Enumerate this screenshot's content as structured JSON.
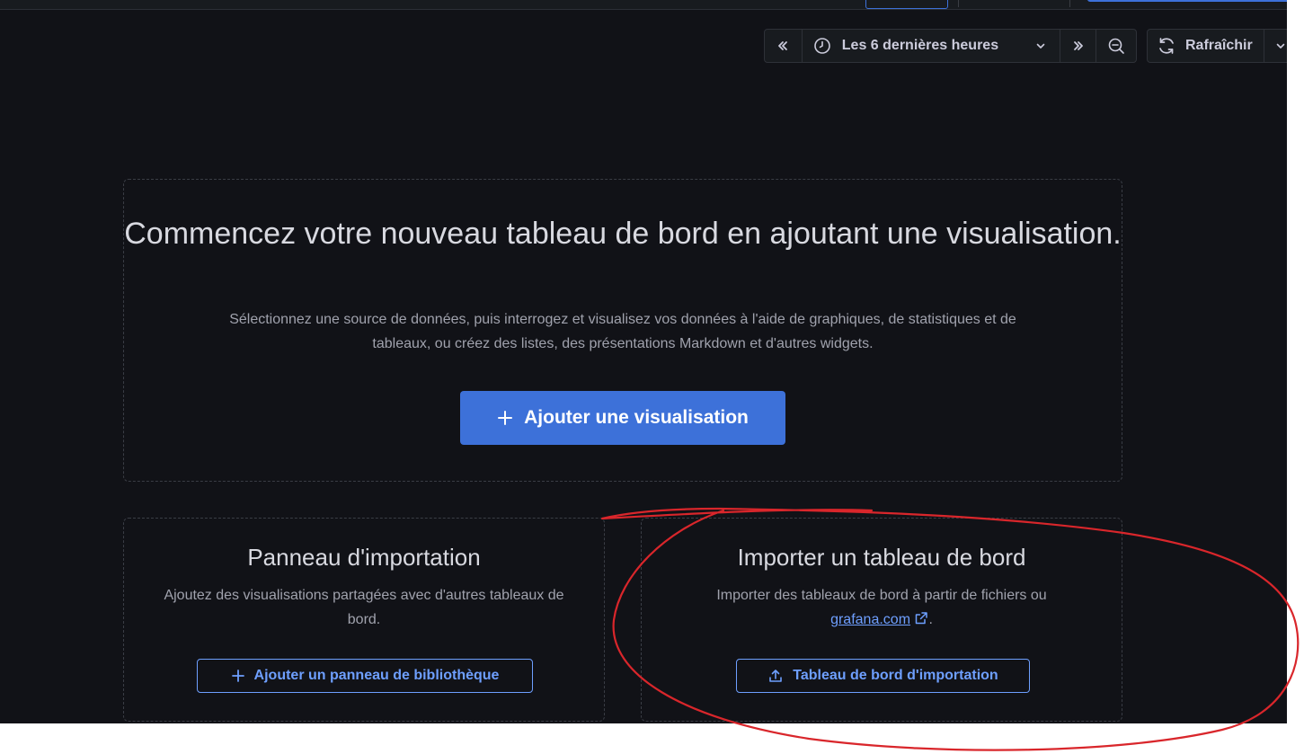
{
  "toolbar": {
    "time_range": "Les 6 dernières heures",
    "refresh": "Rafraîchir"
  },
  "hero": {
    "title": "Commencez votre nouveau tableau de bord en ajoutant une visualisation.",
    "description": "Sélectionnez une source de données, puis interrogez et visualisez vos données à l'aide de graphiques, de statistiques et de tableaux, ou créez des listes, des présentations Markdown et d'autres widgets.",
    "add_visualization": "Ajouter une visualisation"
  },
  "import_panel": {
    "title": "Panneau d'importation",
    "description": "Ajoutez des visualisations partagées avec d'autres tableaux de bord.",
    "button": "Ajouter un panneau de bibliothèque"
  },
  "import_dashboard": {
    "title": "Importer un tableau de bord",
    "description": "Importer des tableaux de bord à partir de fichiers ou",
    "link": "grafana.com",
    "link_suffix": ".",
    "button": "Tableau de bord d'importation"
  },
  "colors": {
    "background": "#111217",
    "accent": "#3d71d9",
    "link": "#6e9fff",
    "annotation": "#d9262b"
  },
  "icons": [
    "chevrons-left-icon",
    "clock-icon",
    "chevron-down-icon",
    "chevrons-right-icon",
    "zoom-out-icon",
    "refresh-icon",
    "plus-icon",
    "external-link-icon",
    "upload-icon"
  ]
}
